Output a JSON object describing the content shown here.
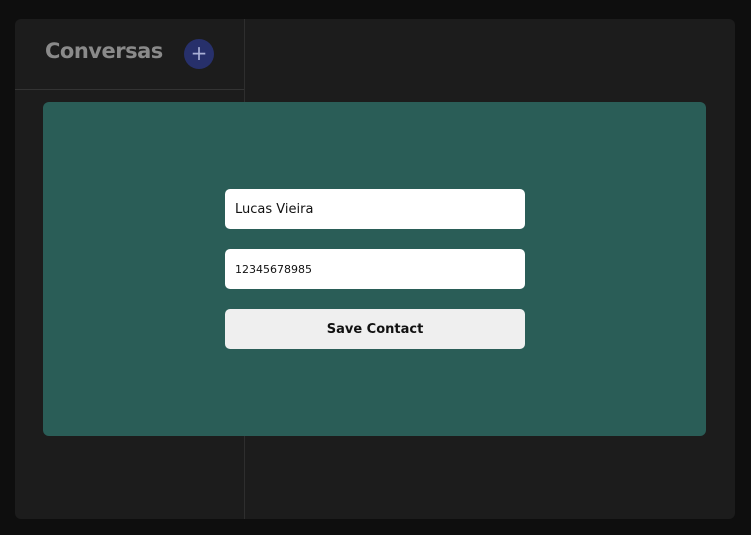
{
  "sidebar": {
    "title": "Conversas",
    "add_button_label": "+"
  },
  "modal": {
    "name_value": "Lucas Vieira",
    "phone_value": "12345678985",
    "save_label": "Save Contact"
  },
  "colors": {
    "modal_background": "#2a5d57",
    "add_button": "#27306b",
    "app_background": "#1c1c1c"
  }
}
